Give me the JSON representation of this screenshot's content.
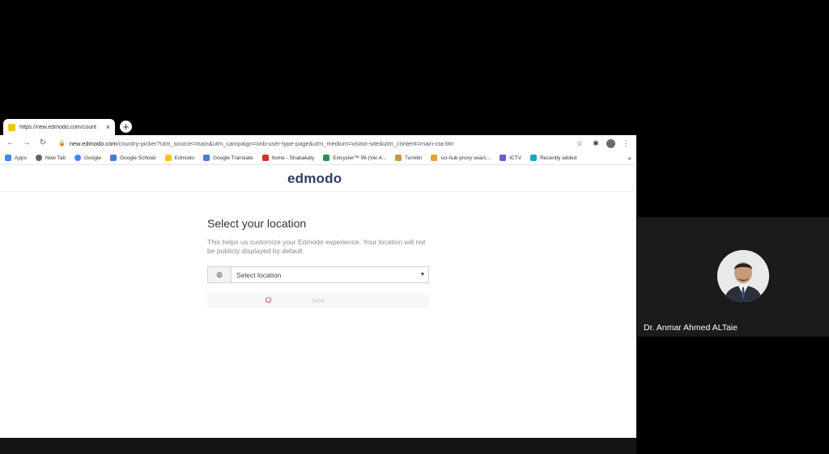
{
  "browser": {
    "tab_title": "https://new.edmodo.com/count",
    "tab_close": "×",
    "new_tab": "+",
    "url_host": "new.edmodo.com",
    "url_rest": "/country-picker?utm_source=main&utm_campaign=onb-user-type-page&utm_medium=visitor-site&utm_content=main-cta-btn",
    "bookmarks": [
      {
        "label": "Apps",
        "icon": "apps-grid-icon",
        "color": "#4285f4"
      },
      {
        "label": "New Tab",
        "icon": "globe-icon",
        "color": "#5f6368"
      },
      {
        "label": "Google",
        "icon": "google-icon",
        "color": "#4285f4"
      },
      {
        "label": "Google Scholar",
        "icon": "scholar-icon",
        "color": "#4a7bd3"
      },
      {
        "label": "Edmodo",
        "icon": "edmodo-icon",
        "color": "#f2c318"
      },
      {
        "label": "Google Translate",
        "icon": "translate-icon",
        "color": "#4a7bd3"
      },
      {
        "label": "home - Shabakaty",
        "icon": "shabakaty-icon",
        "color": "#d93025"
      },
      {
        "label": "Exicycler™ 96 (Ver.4...",
        "icon": "bookmark-b-icon",
        "color": "#2e8b57"
      },
      {
        "label": "Turnitin",
        "icon": "turnitin-icon",
        "color": "#c89b3c"
      },
      {
        "label": "sci-hub proxy searc...",
        "icon": "scihub-icon",
        "color": "#e8a13a"
      },
      {
        "label": "ICTV",
        "icon": "ictv-icon",
        "color": "#6a5acd"
      },
      {
        "label": "Recently added",
        "icon": "folder-icon",
        "color": "#23a2c7"
      }
    ],
    "bookmarks_more": "»"
  },
  "page": {
    "logo": "edmodo",
    "heading": "Select your location",
    "description": "This helps us customize your Edmodo experience. Your location will not be publicly displayed by default",
    "select_placeholder": "Select location",
    "next_label": "Next"
  },
  "meeting": {
    "presenter_name": "Dr. Anmar Ahmed ALTaie"
  },
  "colors": {
    "brand": "#2c3e63",
    "background": "#000000",
    "tile": "#1b1b1b"
  }
}
